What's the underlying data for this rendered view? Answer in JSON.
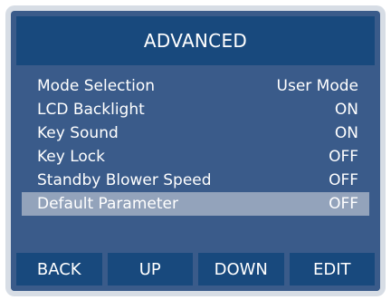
{
  "screen": {
    "title": "ADVANCED"
  },
  "menu": {
    "items": [
      {
        "label": "Mode Selection",
        "value": "User Mode",
        "selected": false
      },
      {
        "label": "LCD Backlight",
        "value": "ON",
        "selected": false
      },
      {
        "label": "Key Sound",
        "value": "ON",
        "selected": false
      },
      {
        "label": "Key Lock",
        "value": "OFF",
        "selected": false
      },
      {
        "label": "Standby Blower Speed",
        "value": "OFF",
        "selected": false
      },
      {
        "label": "Default Parameter",
        "value": "OFF",
        "selected": true
      }
    ]
  },
  "buttons": {
    "back": "BACK",
    "up": "UP",
    "down": "DOWN",
    "edit": "EDIT"
  },
  "colors": {
    "bezel": "#d7dde5",
    "screen_bg": "#3a5b8a",
    "bar_bg": "#18497d",
    "selected_row": "#93a3bb",
    "text": "#ffffff"
  }
}
